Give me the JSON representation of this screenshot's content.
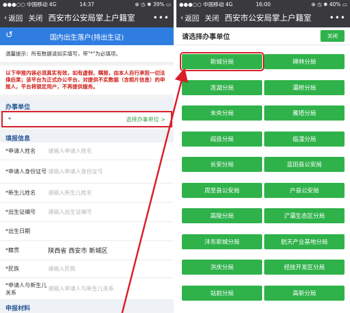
{
  "left": {
    "status": {
      "carrier": "●●●○○ 中国移动  4G",
      "time": "14:37",
      "battery": "⊕ ◷ ✱ 39% ▭"
    },
    "wechat": {
      "back": "返回",
      "close": "关闭",
      "title": "西安市公安局掌上户籍室",
      "more": "•••"
    },
    "header": {
      "back_icon": "↺",
      "title": "国内出生落户(持出生证)"
    },
    "tip": "温馨提示：所有数据请如实填写，带\"*\"为必填项。",
    "warning": "以下申报内容必须真实有效，如有虚假、瞒报，由本人自行承担一切法律后果；该平台为正式办公平台，对提供不实数据（含照片信息）的申报人，平台将锁定用户，不再提供服务。",
    "section_unit": "办事单位",
    "unit_row": {
      "star": "*",
      "pick": "选择办事单位 >"
    },
    "section_info": "填报信息",
    "fields": [
      {
        "label": "*申请人姓名",
        "value": "请输入申请人姓名",
        "filled": false
      },
      {
        "label": "*申请人身份证号",
        "value": "请输入申请人身份证号",
        "filled": false
      },
      {
        "label": "*新生儿姓名",
        "value": "请输入新生儿姓名",
        "filled": false
      },
      {
        "label": "*出生证编号",
        "value": "请输入出生证编号",
        "filled": false
      },
      {
        "label": "*出生日期",
        "value": "",
        "filled": false
      },
      {
        "label": "*籍贯",
        "value": "陕西省 西安市 新城区",
        "filled": true
      },
      {
        "label": "*民族",
        "value": "请输入民族",
        "filled": false
      },
      {
        "label": "*申请人与新生儿关系",
        "value": "请输入申请人与新生儿关系",
        "filled": false
      }
    ],
    "section_materials": "申报材料"
  },
  "right": {
    "status": {
      "carrier": "●●●○○ 中国移动  4G",
      "time": "16:00",
      "battery": "⊕ ◷ ✱ 40% ▭"
    },
    "wechat": {
      "back": "返回",
      "close": "关闭",
      "title": "西安市公安局掌上户籍室",
      "more": "•••"
    },
    "title": "请选择办事单位",
    "close_button": "关闭",
    "units": [
      "新城分局",
      "碑林分局",
      "莲湖分局",
      "灞桥分局",
      "未央分局",
      "雁塔分局",
      "阎良分局",
      "临潼分局",
      "长安分局",
      "蓝田县公安局",
      "周至县公安局",
      "户县公安局",
      "高陵分局",
      "浐灞生态区分局",
      "沣东新城分局",
      "航天产业基地分局",
      "洪庆分局",
      "经技开发区分局",
      "站前分局",
      "高新分局"
    ]
  },
  "colors": {
    "green": "#2fb24a",
    "blue": "#2f7de1",
    "red": "#d8202a",
    "dark": "#39393e"
  }
}
